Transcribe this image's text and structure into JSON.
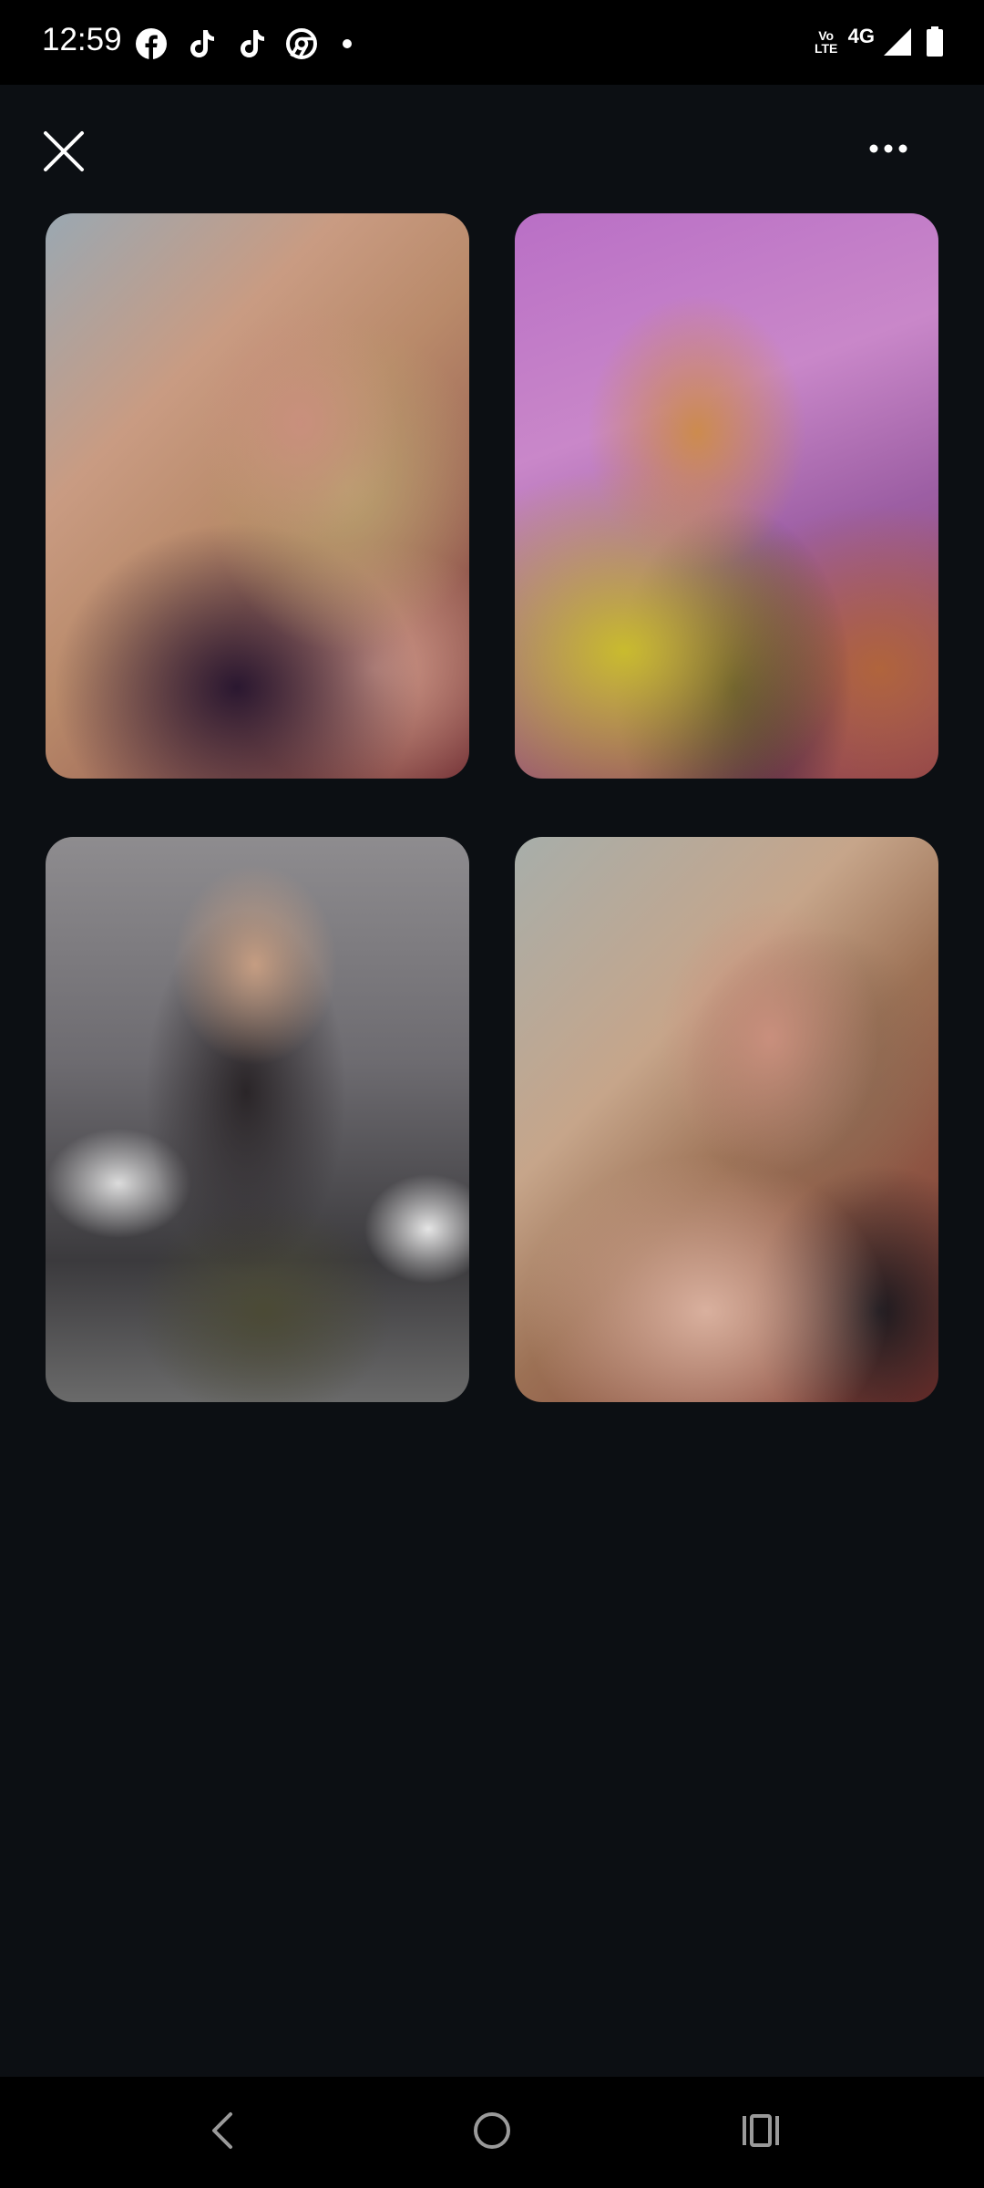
{
  "status_bar": {
    "time": "12:59",
    "notification_icons": [
      "facebook-icon",
      "tiktok-icon",
      "tiktok-icon",
      "chrome-icon",
      "more-notifications-dot"
    ],
    "volte": [
      "Vo",
      "LTE"
    ],
    "network_type": "4G",
    "signal_icon": "cell-signal-icon",
    "battery_icon": "battery-icon"
  },
  "top_bar": {
    "close_icon": "close-icon",
    "more_icon": "more-horizontal-icon"
  },
  "gallery": {
    "photos": [
      {
        "name": "photo-1",
        "description_icon": "image-icon"
      },
      {
        "name": "photo-2",
        "description_icon": "image-icon"
      },
      {
        "name": "photo-3",
        "description_icon": "image-icon"
      },
      {
        "name": "photo-4",
        "description_icon": "image-icon"
      }
    ]
  },
  "nav_bar": {
    "back_icon": "back-chevron-icon",
    "home_icon": "home-circle-icon",
    "recents_icon": "recents-icon"
  },
  "colors": {
    "background": "#0c0f13",
    "system_bars": "#000000",
    "icon": "#ffffff"
  }
}
